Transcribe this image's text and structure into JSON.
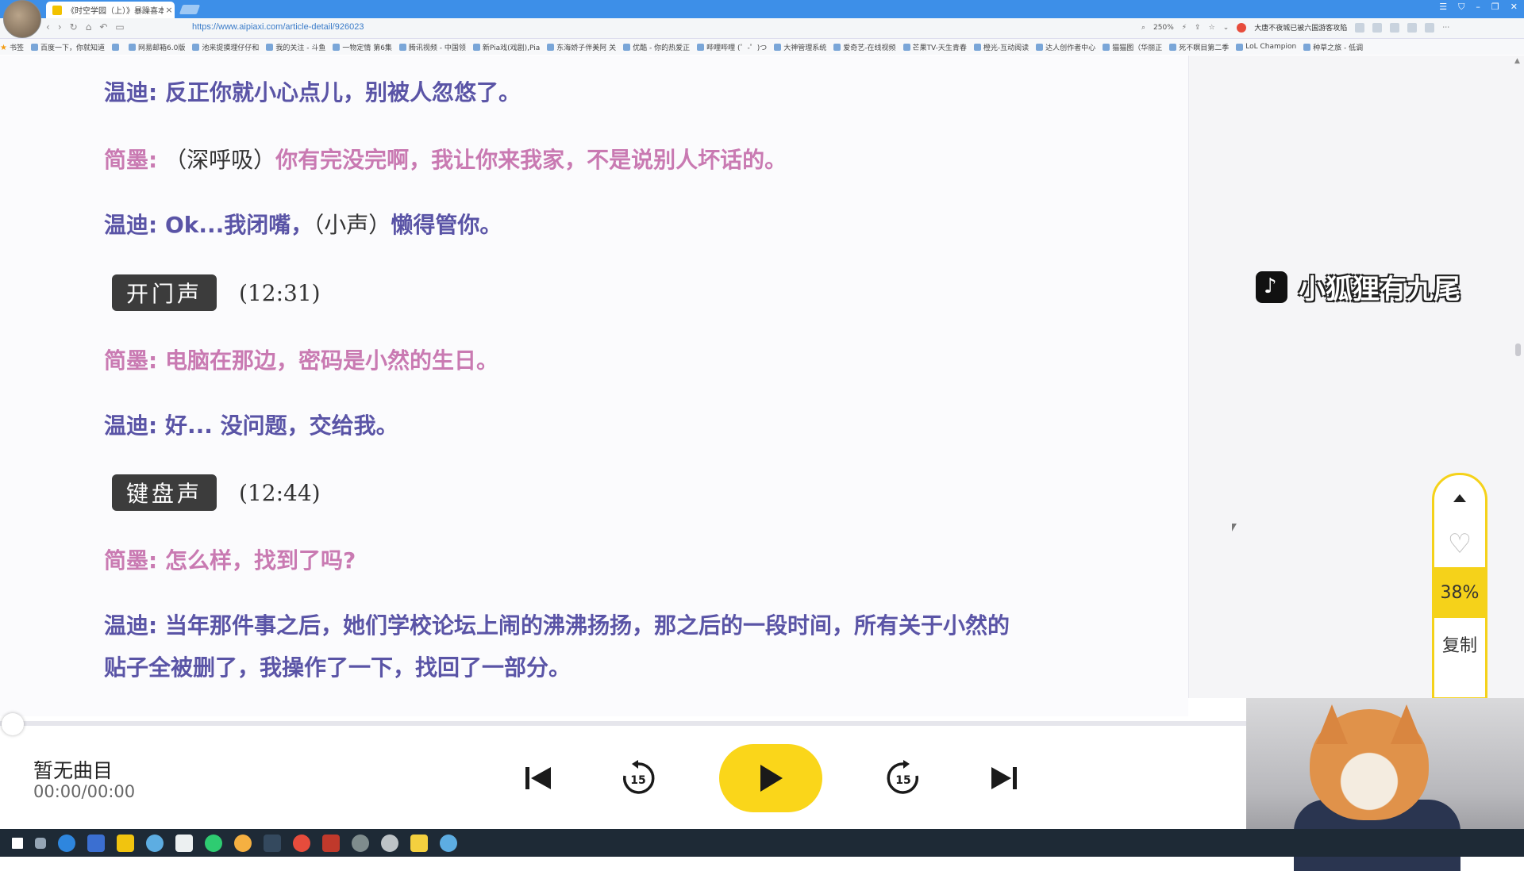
{
  "browser": {
    "tab_title": "《时空学园（上）》暴躁喜本（",
    "tab_close": "×",
    "url": "https://www.aipiaxi.com/article-detail/926023",
    "zoom": "250%",
    "news_ticker": "大唐不夜城已被六国游客攻陷",
    "nav_icons": [
      "chevron-left-icon",
      "chevron-right-icon",
      "refresh-icon",
      "home-icon",
      "undo-icon",
      "book-icon"
    ]
  },
  "bookmarks": [
    "书签",
    "百度一下，你就知道",
    "",
    "网易邮箱6.0版",
    "池来提摸理仔仔和",
    "我的关注 - 斗鱼",
    "一物定情 第6集",
    "腾讯视频 - 中国领",
    "新Pia戏(戏剧),Pia",
    "东海娇子伴美阿 关",
    "优酷 - 你的热爱正",
    "哔哩哔哩 (゜-゜)つ",
    "大神管理系统",
    "爱奇艺-在线视频",
    "芒果TV-天生青春",
    "橙光-互动阅读",
    "达人创作者中心",
    "猫猫图（华丽正",
    "死不瞑目第二季",
    "LoL Champion",
    "种草之旅 - 低调"
  ],
  "script": {
    "lines": [
      {
        "speaker": "温迪:",
        "aside": "",
        "text": " 反正你就小心点儿，别被人忽悠了。"
      },
      {
        "speaker": "简墨:",
        "aside": " （深呼吸）",
        "text": "你有完没完啊，我让你来我家，不是说别人坏话的。"
      },
      {
        "speaker": "温迪:",
        "aside": "",
        "text": " Ok...我闭嘴，"
      },
      {
        "speaker": "简墨:",
        "aside": "",
        "text": " 电脑在那边，密码是小然的生日。"
      },
      {
        "speaker": "温迪:",
        "aside": "",
        "text": " 好... 没问题，交给我。"
      },
      {
        "speaker": "简墨:",
        "aside": "",
        "text": " 怎么样，找到了吗?"
      },
      {
        "speaker": "温迪:",
        "aside": "",
        "text": " 当年那件事之后，她们学校论坛上闹的沸沸扬扬，那之后的一段时间，所有关于小然的"
      },
      {
        "speaker": "",
        "aside": "",
        "text": "贴子全被删了，我操作了一下，找回了一部分。"
      }
    ],
    "line3_aside": "（小声）",
    "line3_tail": "懒得管你。",
    "sfx": [
      {
        "tag": "开门声",
        "time": "(12:31)"
      },
      {
        "tag": "键盘声",
        "time": "(12:44)"
      }
    ]
  },
  "watermark": "小狐狸有九尾",
  "float_widget": {
    "progress": "38%",
    "copy_label": "复制",
    "heart_icon": "♡"
  },
  "player": {
    "track": "暂无曲目",
    "time": "00:00/00:00",
    "progress": 0
  },
  "taskbar": {
    "clock": ""
  },
  "colors": {
    "speaker_blue": "#5a54a6",
    "speaker_pink": "#c97ab2",
    "accent_yellow": "#fad61a",
    "titlebar_blue": "#3d8fe8"
  }
}
